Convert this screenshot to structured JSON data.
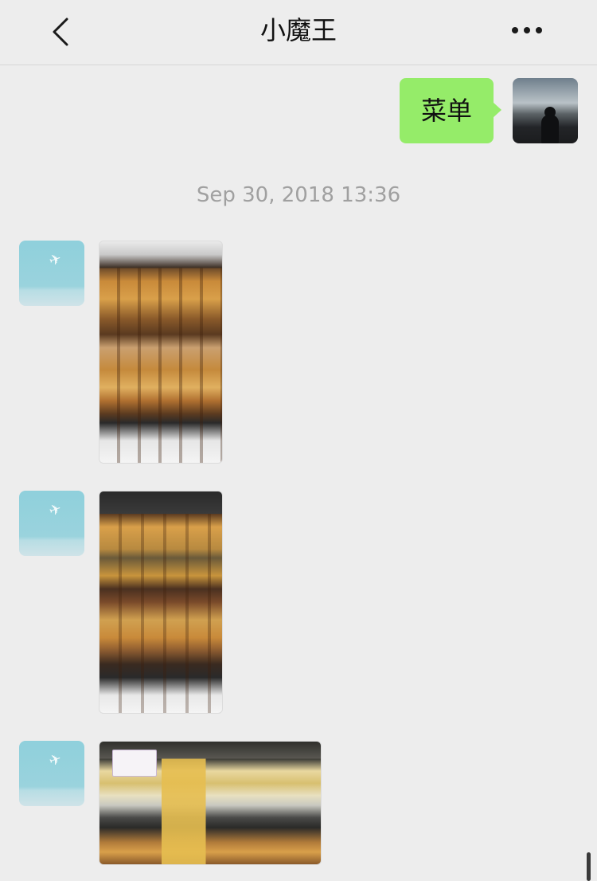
{
  "navbar": {
    "title": "小魔王",
    "back_icon": "chevron-left-icon",
    "more_icon": "more-dots-icon"
  },
  "messages": {
    "sent_text": "菜单",
    "timestamp": "Sep 30, 2018 13:36"
  },
  "colors": {
    "background": "#ededed",
    "sent_bubble": "#95ec69",
    "timestamp_text": "#a0a0a0"
  }
}
